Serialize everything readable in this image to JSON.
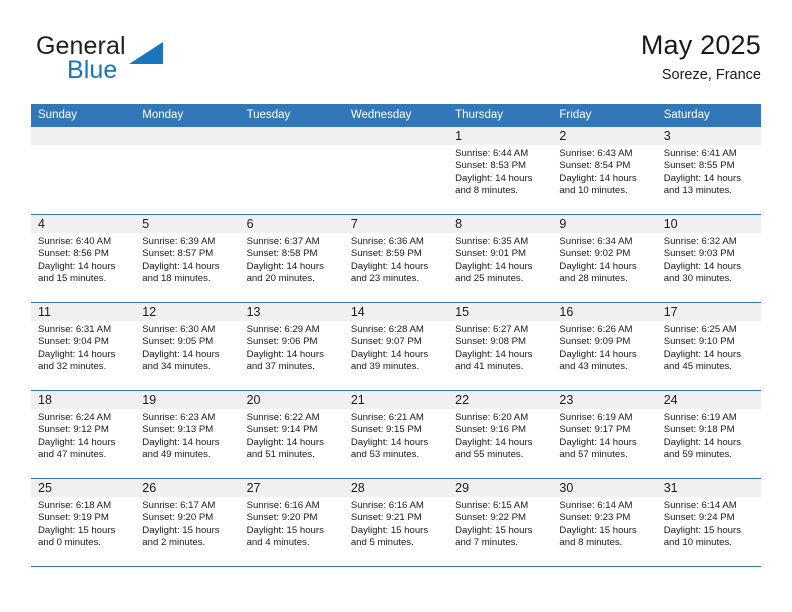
{
  "brand": {
    "name_top": "General",
    "name_bottom": "Blue",
    "accent_color": "#1b75bb",
    "triangle_icon": "triangle-icon"
  },
  "header": {
    "title": "May 2025",
    "subtitle": "Soreze, France"
  },
  "theme": {
    "header_row_color": "#3278b9",
    "daynum_band_color": "#f0f0f0",
    "row_divider_color": "#3278b9"
  },
  "weekday_headers": [
    "Sunday",
    "Monday",
    "Tuesday",
    "Wednesday",
    "Thursday",
    "Friday",
    "Saturday"
  ],
  "labels": {
    "sunrise_prefix": "Sunrise:",
    "sunset_prefix": "Sunset:",
    "daylight_prefix": "Daylight:"
  },
  "weeks": [
    [
      {
        "day": "",
        "empty": true
      },
      {
        "day": "",
        "empty": true
      },
      {
        "day": "",
        "empty": true
      },
      {
        "day": "",
        "empty": true
      },
      {
        "day": "1",
        "sunrise": "Sunrise: 6:44 AM",
        "sunset": "Sunset: 8:53 PM",
        "daylight_1": "Daylight: 14 hours",
        "daylight_2": "and 8 minutes."
      },
      {
        "day": "2",
        "sunrise": "Sunrise: 6:43 AM",
        "sunset": "Sunset: 8:54 PM",
        "daylight_1": "Daylight: 14 hours",
        "daylight_2": "and 10 minutes."
      },
      {
        "day": "3",
        "sunrise": "Sunrise: 6:41 AM",
        "sunset": "Sunset: 8:55 PM",
        "daylight_1": "Daylight: 14 hours",
        "daylight_2": "and 13 minutes."
      }
    ],
    [
      {
        "day": "4",
        "sunrise": "Sunrise: 6:40 AM",
        "sunset": "Sunset: 8:56 PM",
        "daylight_1": "Daylight: 14 hours",
        "daylight_2": "and 15 minutes."
      },
      {
        "day": "5",
        "sunrise": "Sunrise: 6:39 AM",
        "sunset": "Sunset: 8:57 PM",
        "daylight_1": "Daylight: 14 hours",
        "daylight_2": "and 18 minutes."
      },
      {
        "day": "6",
        "sunrise": "Sunrise: 6:37 AM",
        "sunset": "Sunset: 8:58 PM",
        "daylight_1": "Daylight: 14 hours",
        "daylight_2": "and 20 minutes."
      },
      {
        "day": "7",
        "sunrise": "Sunrise: 6:36 AM",
        "sunset": "Sunset: 8:59 PM",
        "daylight_1": "Daylight: 14 hours",
        "daylight_2": "and 23 minutes."
      },
      {
        "day": "8",
        "sunrise": "Sunrise: 6:35 AM",
        "sunset": "Sunset: 9:01 PM",
        "daylight_1": "Daylight: 14 hours",
        "daylight_2": "and 25 minutes."
      },
      {
        "day": "9",
        "sunrise": "Sunrise: 6:34 AM",
        "sunset": "Sunset: 9:02 PM",
        "daylight_1": "Daylight: 14 hours",
        "daylight_2": "and 28 minutes."
      },
      {
        "day": "10",
        "sunrise": "Sunrise: 6:32 AM",
        "sunset": "Sunset: 9:03 PM",
        "daylight_1": "Daylight: 14 hours",
        "daylight_2": "and 30 minutes."
      }
    ],
    [
      {
        "day": "11",
        "sunrise": "Sunrise: 6:31 AM",
        "sunset": "Sunset: 9:04 PM",
        "daylight_1": "Daylight: 14 hours",
        "daylight_2": "and 32 minutes."
      },
      {
        "day": "12",
        "sunrise": "Sunrise: 6:30 AM",
        "sunset": "Sunset: 9:05 PM",
        "daylight_1": "Daylight: 14 hours",
        "daylight_2": "and 34 minutes."
      },
      {
        "day": "13",
        "sunrise": "Sunrise: 6:29 AM",
        "sunset": "Sunset: 9:06 PM",
        "daylight_1": "Daylight: 14 hours",
        "daylight_2": "and 37 minutes."
      },
      {
        "day": "14",
        "sunrise": "Sunrise: 6:28 AM",
        "sunset": "Sunset: 9:07 PM",
        "daylight_1": "Daylight: 14 hours",
        "daylight_2": "and 39 minutes."
      },
      {
        "day": "15",
        "sunrise": "Sunrise: 6:27 AM",
        "sunset": "Sunset: 9:08 PM",
        "daylight_1": "Daylight: 14 hours",
        "daylight_2": "and 41 minutes."
      },
      {
        "day": "16",
        "sunrise": "Sunrise: 6:26 AM",
        "sunset": "Sunset: 9:09 PM",
        "daylight_1": "Daylight: 14 hours",
        "daylight_2": "and 43 minutes."
      },
      {
        "day": "17",
        "sunrise": "Sunrise: 6:25 AM",
        "sunset": "Sunset: 9:10 PM",
        "daylight_1": "Daylight: 14 hours",
        "daylight_2": "and 45 minutes."
      }
    ],
    [
      {
        "day": "18",
        "sunrise": "Sunrise: 6:24 AM",
        "sunset": "Sunset: 9:12 PM",
        "daylight_1": "Daylight: 14 hours",
        "daylight_2": "and 47 minutes."
      },
      {
        "day": "19",
        "sunrise": "Sunrise: 6:23 AM",
        "sunset": "Sunset: 9:13 PM",
        "daylight_1": "Daylight: 14 hours",
        "daylight_2": "and 49 minutes."
      },
      {
        "day": "20",
        "sunrise": "Sunrise: 6:22 AM",
        "sunset": "Sunset: 9:14 PM",
        "daylight_1": "Daylight: 14 hours",
        "daylight_2": "and 51 minutes."
      },
      {
        "day": "21",
        "sunrise": "Sunrise: 6:21 AM",
        "sunset": "Sunset: 9:15 PM",
        "daylight_1": "Daylight: 14 hours",
        "daylight_2": "and 53 minutes."
      },
      {
        "day": "22",
        "sunrise": "Sunrise: 6:20 AM",
        "sunset": "Sunset: 9:16 PM",
        "daylight_1": "Daylight: 14 hours",
        "daylight_2": "and 55 minutes."
      },
      {
        "day": "23",
        "sunrise": "Sunrise: 6:19 AM",
        "sunset": "Sunset: 9:17 PM",
        "daylight_1": "Daylight: 14 hours",
        "daylight_2": "and 57 minutes."
      },
      {
        "day": "24",
        "sunrise": "Sunrise: 6:19 AM",
        "sunset": "Sunset: 9:18 PM",
        "daylight_1": "Daylight: 14 hours",
        "daylight_2": "and 59 minutes."
      }
    ],
    [
      {
        "day": "25",
        "sunrise": "Sunrise: 6:18 AM",
        "sunset": "Sunset: 9:19 PM",
        "daylight_1": "Daylight: 15 hours",
        "daylight_2": "and 0 minutes."
      },
      {
        "day": "26",
        "sunrise": "Sunrise: 6:17 AM",
        "sunset": "Sunset: 9:20 PM",
        "daylight_1": "Daylight: 15 hours",
        "daylight_2": "and 2 minutes."
      },
      {
        "day": "27",
        "sunrise": "Sunrise: 6:16 AM",
        "sunset": "Sunset: 9:20 PM",
        "daylight_1": "Daylight: 15 hours",
        "daylight_2": "and 4 minutes."
      },
      {
        "day": "28",
        "sunrise": "Sunrise: 6:16 AM",
        "sunset": "Sunset: 9:21 PM",
        "daylight_1": "Daylight: 15 hours",
        "daylight_2": "and 5 minutes."
      },
      {
        "day": "29",
        "sunrise": "Sunrise: 6:15 AM",
        "sunset": "Sunset: 9:22 PM",
        "daylight_1": "Daylight: 15 hours",
        "daylight_2": "and 7 minutes."
      },
      {
        "day": "30",
        "sunrise": "Sunrise: 6:14 AM",
        "sunset": "Sunset: 9:23 PM",
        "daylight_1": "Daylight: 15 hours",
        "daylight_2": "and 8 minutes."
      },
      {
        "day": "31",
        "sunrise": "Sunrise: 6:14 AM",
        "sunset": "Sunset: 9:24 PM",
        "daylight_1": "Daylight: 15 hours",
        "daylight_2": "and 10 minutes."
      }
    ]
  ]
}
